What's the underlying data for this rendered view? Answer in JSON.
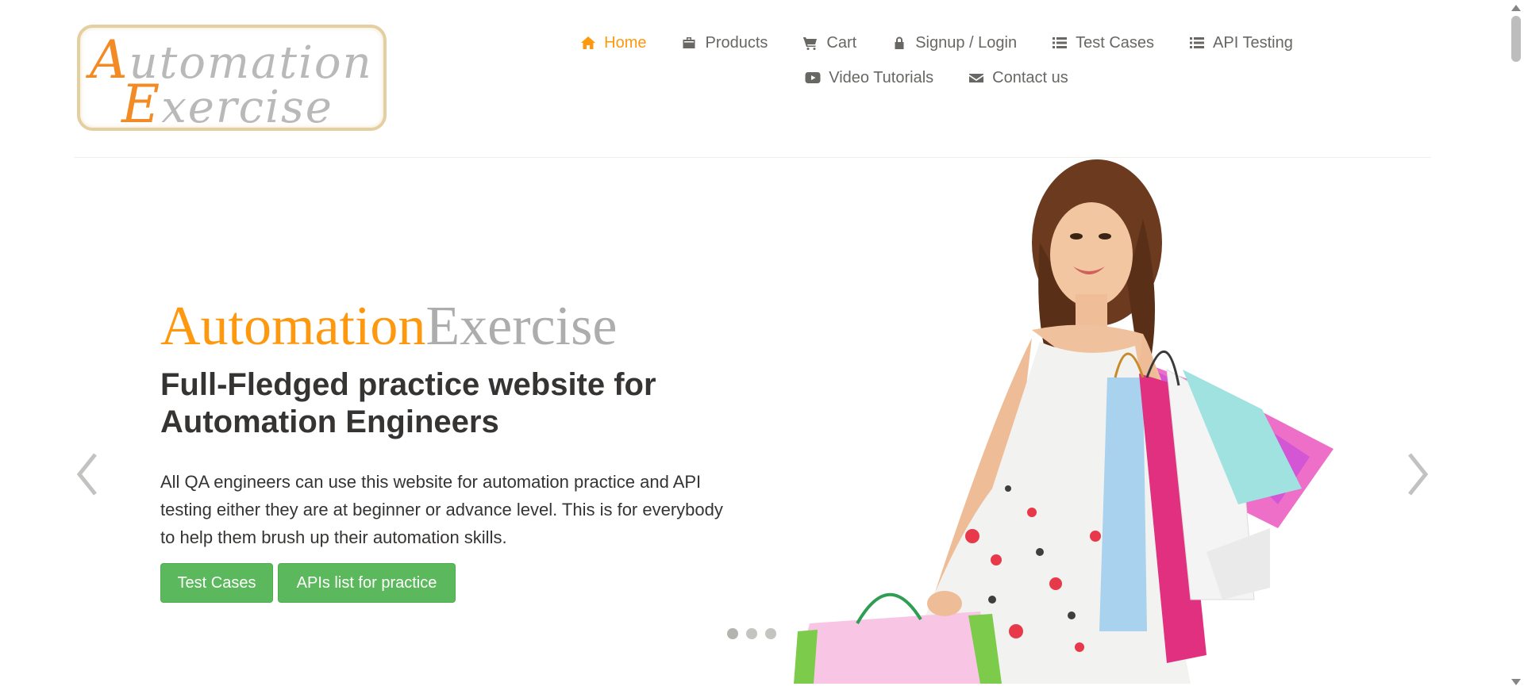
{
  "header": {
    "logo": {
      "line1_cap": "A",
      "line1_rest": "utomation",
      "line2_cap": "E",
      "line2_rest": "xercise"
    },
    "nav": [
      {
        "label": "Home",
        "icon": "home-icon",
        "active": true
      },
      {
        "label": "Products",
        "icon": "briefcase-icon",
        "active": false
      },
      {
        "label": "Cart",
        "icon": "cart-icon",
        "active": false
      },
      {
        "label": "Signup / Login",
        "icon": "lock-icon",
        "active": false
      },
      {
        "label": "Test Cases",
        "icon": "list-icon",
        "active": false
      },
      {
        "label": "API Testing",
        "icon": "list-icon",
        "active": false
      },
      {
        "label": "Video Tutorials",
        "icon": "youtube-play-icon",
        "active": false
      },
      {
        "label": "Contact us",
        "icon": "envelope-icon",
        "active": false
      }
    ]
  },
  "slider": {
    "brand_part1": "Automation",
    "brand_part2": "Exercise",
    "headline": "Full-Fledged practice website for Automation Engineers",
    "description": "All QA engineers can use this website for automation practice and API testing either they are at beginner or advance level. This is for everybody to help them brush up their automation skills.",
    "buttons": {
      "test_cases": "Test Cases",
      "apis_list": "APIs list for practice"
    },
    "slide_count": 3,
    "active_slide": 1
  },
  "colors": {
    "accent": "#fe980f",
    "nav_text": "#696763",
    "button_green": "#5cb85c",
    "brand_gray": "#adadad",
    "heading": "#363432"
  }
}
